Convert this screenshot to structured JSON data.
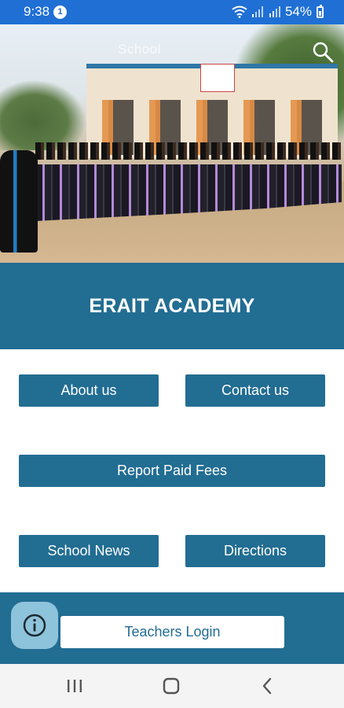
{
  "status_bar": {
    "time": "9:38",
    "notification_count": "1",
    "battery": "54%"
  },
  "hero": {
    "watermark_text": "School",
    "icons": {
      "search": "search-icon"
    }
  },
  "header": {
    "title": "ERAIT ACADEMY"
  },
  "menu": {
    "about_label": "About us",
    "contact_label": "Contact us",
    "fees_label": "Report Paid Fees",
    "news_label": "School News",
    "directions_label": "Directions"
  },
  "footer": {
    "teachers_login_label": "Teachers Login",
    "info_icon": "info-icon"
  },
  "nav_bar": {
    "icons": [
      "recents-icon",
      "home-icon",
      "back-icon"
    ]
  },
  "colors": {
    "status_bar": "#1f6fd4",
    "primary": "#226d92",
    "fab": "#8ec3dc",
    "nav_bar": "#f4f4f4"
  }
}
